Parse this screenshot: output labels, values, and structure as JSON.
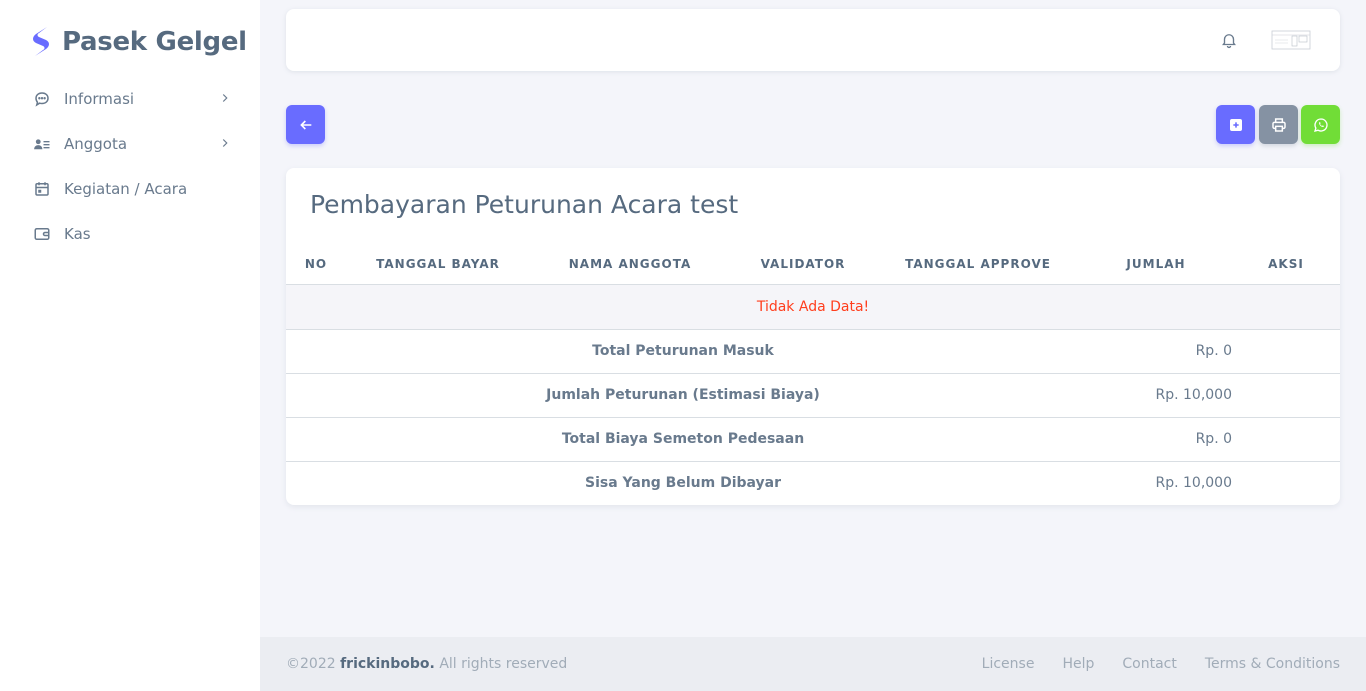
{
  "brand": {
    "name": "Pasek Gelgel",
    "accent": "#696cff"
  },
  "sidebar": {
    "items": [
      {
        "label": "Informasi",
        "icon": "chat-bubble-icon",
        "has_submenu": true
      },
      {
        "label": "Anggota",
        "icon": "user-list-icon",
        "has_submenu": true
      },
      {
        "label": "Kegiatan / Acara",
        "icon": "calendar-icon",
        "has_submenu": false
      },
      {
        "label": "Kas",
        "icon": "wallet-icon",
        "has_submenu": false
      }
    ]
  },
  "navbar": {
    "notification_icon": "bell-icon",
    "avatar_icon": "avatar-image"
  },
  "actions": {
    "back_icon": "arrow-left-icon",
    "add_icon": "plus-square-icon",
    "print_icon": "printer-icon",
    "whatsapp_icon": "whatsapp-icon"
  },
  "card": {
    "title": "Pembayaran Peturunan Acara test",
    "table": {
      "columns": [
        "NO",
        "TANGGAL BAYAR",
        "NAMA ANGGOTA",
        "VALIDATOR",
        "TANGGAL APPROVE",
        "JUMLAH",
        "AKSI"
      ],
      "empty_message": "Tidak Ada Data!"
    },
    "summary": [
      {
        "label": "Total Peturunan Masuk",
        "value": "Rp. 0"
      },
      {
        "label": "Jumlah Peturunan (Estimasi Biaya)",
        "value": "Rp. 10,000"
      },
      {
        "label": "Total Biaya Semeton Pedesaan",
        "value": "Rp. 0"
      },
      {
        "label": "Sisa Yang Belum Dibayar",
        "value": "Rp. 10,000"
      }
    ]
  },
  "footer": {
    "copyright_prefix": "©2022",
    "author": "frickinbobo.",
    "rights": "All rights reserved",
    "links": [
      "License",
      "Help",
      "Contact",
      "Terms & Conditions"
    ]
  }
}
